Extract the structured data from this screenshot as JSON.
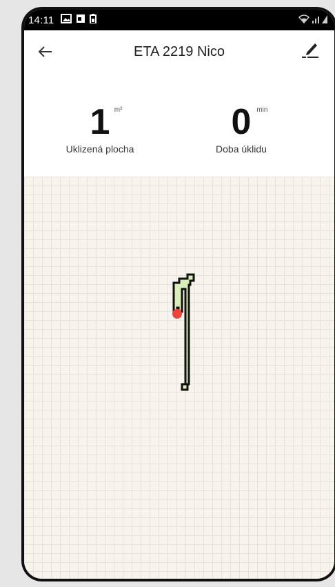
{
  "status_bar": {
    "time": "14:11",
    "icons": [
      "image-icon",
      "calendar-icon",
      "battery-saver-icon"
    ],
    "right_icons": [
      "wifi-icon",
      "signal-icon",
      "battery-icon"
    ]
  },
  "app_bar": {
    "title": "ETA 2219 Nico",
    "back_icon": "arrow-back-icon",
    "edit_icon": "edit-pencil-icon"
  },
  "stats": {
    "cleaned_area": {
      "value": "1",
      "unit": "m²",
      "label": "Uklizená plocha"
    },
    "duration": {
      "value": "0",
      "unit": "min",
      "label": "Doba úklidu"
    }
  },
  "map": {
    "area_fill_color": "#d8f0b8",
    "outline_color": "#111111",
    "robot_color": "#f04438"
  }
}
